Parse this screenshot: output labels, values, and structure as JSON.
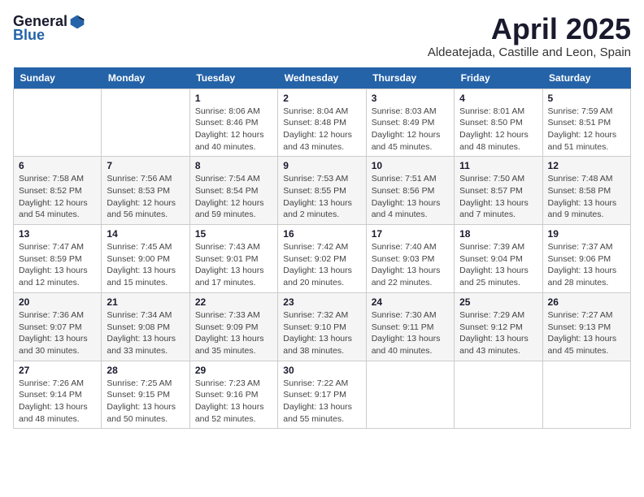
{
  "logo": {
    "general": "General",
    "blue": "Blue"
  },
  "header": {
    "month_year": "April 2025",
    "location": "Aldeatejada, Castille and Leon, Spain"
  },
  "weekdays": [
    "Sunday",
    "Monday",
    "Tuesday",
    "Wednesday",
    "Thursday",
    "Friday",
    "Saturday"
  ],
  "weeks": [
    [
      {
        "day": "",
        "sunrise": "",
        "sunset": "",
        "daylight": ""
      },
      {
        "day": "",
        "sunrise": "",
        "sunset": "",
        "daylight": ""
      },
      {
        "day": "1",
        "sunrise": "Sunrise: 8:06 AM",
        "sunset": "Sunset: 8:46 PM",
        "daylight": "Daylight: 12 hours and 40 minutes."
      },
      {
        "day": "2",
        "sunrise": "Sunrise: 8:04 AM",
        "sunset": "Sunset: 8:48 PM",
        "daylight": "Daylight: 12 hours and 43 minutes."
      },
      {
        "day": "3",
        "sunrise": "Sunrise: 8:03 AM",
        "sunset": "Sunset: 8:49 PM",
        "daylight": "Daylight: 12 hours and 45 minutes."
      },
      {
        "day": "4",
        "sunrise": "Sunrise: 8:01 AM",
        "sunset": "Sunset: 8:50 PM",
        "daylight": "Daylight: 12 hours and 48 minutes."
      },
      {
        "day": "5",
        "sunrise": "Sunrise: 7:59 AM",
        "sunset": "Sunset: 8:51 PM",
        "daylight": "Daylight: 12 hours and 51 minutes."
      }
    ],
    [
      {
        "day": "6",
        "sunrise": "Sunrise: 7:58 AM",
        "sunset": "Sunset: 8:52 PM",
        "daylight": "Daylight: 12 hours and 54 minutes."
      },
      {
        "day": "7",
        "sunrise": "Sunrise: 7:56 AM",
        "sunset": "Sunset: 8:53 PM",
        "daylight": "Daylight: 12 hours and 56 minutes."
      },
      {
        "day": "8",
        "sunrise": "Sunrise: 7:54 AM",
        "sunset": "Sunset: 8:54 PM",
        "daylight": "Daylight: 12 hours and 59 minutes."
      },
      {
        "day": "9",
        "sunrise": "Sunrise: 7:53 AM",
        "sunset": "Sunset: 8:55 PM",
        "daylight": "Daylight: 13 hours and 2 minutes."
      },
      {
        "day": "10",
        "sunrise": "Sunrise: 7:51 AM",
        "sunset": "Sunset: 8:56 PM",
        "daylight": "Daylight: 13 hours and 4 minutes."
      },
      {
        "day": "11",
        "sunrise": "Sunrise: 7:50 AM",
        "sunset": "Sunset: 8:57 PM",
        "daylight": "Daylight: 13 hours and 7 minutes."
      },
      {
        "day": "12",
        "sunrise": "Sunrise: 7:48 AM",
        "sunset": "Sunset: 8:58 PM",
        "daylight": "Daylight: 13 hours and 9 minutes."
      }
    ],
    [
      {
        "day": "13",
        "sunrise": "Sunrise: 7:47 AM",
        "sunset": "Sunset: 8:59 PM",
        "daylight": "Daylight: 13 hours and 12 minutes."
      },
      {
        "day": "14",
        "sunrise": "Sunrise: 7:45 AM",
        "sunset": "Sunset: 9:00 PM",
        "daylight": "Daylight: 13 hours and 15 minutes."
      },
      {
        "day": "15",
        "sunrise": "Sunrise: 7:43 AM",
        "sunset": "Sunset: 9:01 PM",
        "daylight": "Daylight: 13 hours and 17 minutes."
      },
      {
        "day": "16",
        "sunrise": "Sunrise: 7:42 AM",
        "sunset": "Sunset: 9:02 PM",
        "daylight": "Daylight: 13 hours and 20 minutes."
      },
      {
        "day": "17",
        "sunrise": "Sunrise: 7:40 AM",
        "sunset": "Sunset: 9:03 PM",
        "daylight": "Daylight: 13 hours and 22 minutes."
      },
      {
        "day": "18",
        "sunrise": "Sunrise: 7:39 AM",
        "sunset": "Sunset: 9:04 PM",
        "daylight": "Daylight: 13 hours and 25 minutes."
      },
      {
        "day": "19",
        "sunrise": "Sunrise: 7:37 AM",
        "sunset": "Sunset: 9:06 PM",
        "daylight": "Daylight: 13 hours and 28 minutes."
      }
    ],
    [
      {
        "day": "20",
        "sunrise": "Sunrise: 7:36 AM",
        "sunset": "Sunset: 9:07 PM",
        "daylight": "Daylight: 13 hours and 30 minutes."
      },
      {
        "day": "21",
        "sunrise": "Sunrise: 7:34 AM",
        "sunset": "Sunset: 9:08 PM",
        "daylight": "Daylight: 13 hours and 33 minutes."
      },
      {
        "day": "22",
        "sunrise": "Sunrise: 7:33 AM",
        "sunset": "Sunset: 9:09 PM",
        "daylight": "Daylight: 13 hours and 35 minutes."
      },
      {
        "day": "23",
        "sunrise": "Sunrise: 7:32 AM",
        "sunset": "Sunset: 9:10 PM",
        "daylight": "Daylight: 13 hours and 38 minutes."
      },
      {
        "day": "24",
        "sunrise": "Sunrise: 7:30 AM",
        "sunset": "Sunset: 9:11 PM",
        "daylight": "Daylight: 13 hours and 40 minutes."
      },
      {
        "day": "25",
        "sunrise": "Sunrise: 7:29 AM",
        "sunset": "Sunset: 9:12 PM",
        "daylight": "Daylight: 13 hours and 43 minutes."
      },
      {
        "day": "26",
        "sunrise": "Sunrise: 7:27 AM",
        "sunset": "Sunset: 9:13 PM",
        "daylight": "Daylight: 13 hours and 45 minutes."
      }
    ],
    [
      {
        "day": "27",
        "sunrise": "Sunrise: 7:26 AM",
        "sunset": "Sunset: 9:14 PM",
        "daylight": "Daylight: 13 hours and 48 minutes."
      },
      {
        "day": "28",
        "sunrise": "Sunrise: 7:25 AM",
        "sunset": "Sunset: 9:15 PM",
        "daylight": "Daylight: 13 hours and 50 minutes."
      },
      {
        "day": "29",
        "sunrise": "Sunrise: 7:23 AM",
        "sunset": "Sunset: 9:16 PM",
        "daylight": "Daylight: 13 hours and 52 minutes."
      },
      {
        "day": "30",
        "sunrise": "Sunrise: 7:22 AM",
        "sunset": "Sunset: 9:17 PM",
        "daylight": "Daylight: 13 hours and 55 minutes."
      },
      {
        "day": "",
        "sunrise": "",
        "sunset": "",
        "daylight": ""
      },
      {
        "day": "",
        "sunrise": "",
        "sunset": "",
        "daylight": ""
      },
      {
        "day": "",
        "sunrise": "",
        "sunset": "",
        "daylight": ""
      }
    ]
  ]
}
